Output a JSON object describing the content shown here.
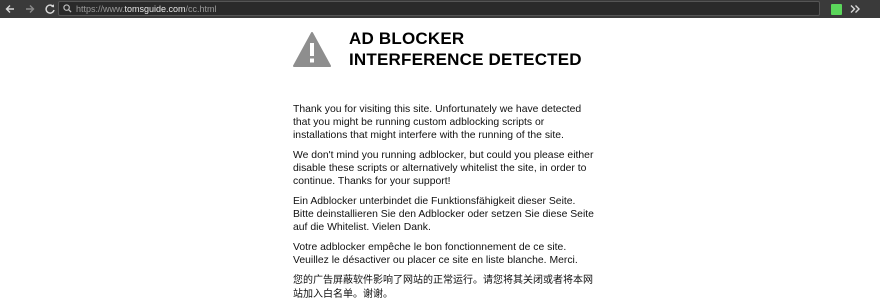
{
  "browser": {
    "url_prefix": "https://www.",
    "url_host": "tomsguide.com",
    "url_path": "/cc.html",
    "extension_color": "#5bd65b"
  },
  "icons": {
    "back": "arrow-left-icon",
    "forward": "arrow-right-icon",
    "reload": "reload-icon",
    "search": "search-icon",
    "extension": "extension-icon",
    "more": "double-chevron-right-icon",
    "warning": "warning-triangle-icon"
  },
  "page": {
    "headline_line1": "AD BLOCKER",
    "headline_line2": "INTERFERENCE DETECTED",
    "p_en1": "Thank you for visiting this site. Unfortunately we have detected that you might be running custom adblocking scripts or installations that might interfere with the running of the site.",
    "p_en2": "We don't mind you running adblocker, but could you please either disable these scripts or alternatively whitelist the site, in order to continue. Thanks for your support!",
    "p_de": "Ein Adblocker unterbindet die Funktionsfähigkeit dieser Seite. Bitte deinstallieren Sie den Adblocker oder setzen Sie diese Seite auf die Whitelist. Vielen Dank.",
    "p_fr": "Votre adblocker empêche le bon fonctionnement de ce site. Veuillez le désactiver ou placer ce site en liste blanche. Merci.",
    "p_zh": "您的广告屏蔽软件影响了网站的正常运行。请您将其关闭或者将本网站加入白名单。谢谢。"
  }
}
